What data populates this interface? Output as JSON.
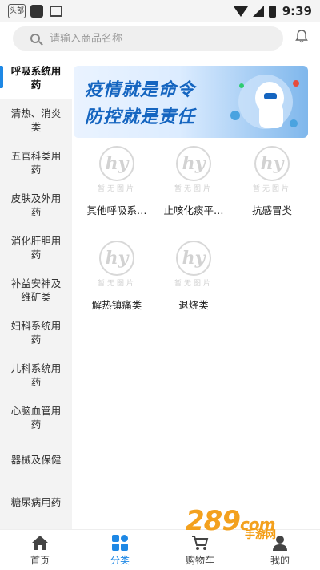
{
  "status_bar": {
    "app_badge": "头部",
    "time": "9:39"
  },
  "search": {
    "placeholder": "请输入商品名称"
  },
  "sidebar": {
    "items": [
      {
        "label": "呼吸系统用药",
        "active": true
      },
      {
        "label": "清热、消炎类"
      },
      {
        "label": "五官科类用药"
      },
      {
        "label": "皮肤及外用药"
      },
      {
        "label": "消化肝胆用药"
      },
      {
        "label": "补益安神及维矿类"
      },
      {
        "label": "妇科系统用药"
      },
      {
        "label": "儿科系统用药"
      },
      {
        "label": "心脑血管用药"
      },
      {
        "label": "器械及保健"
      },
      {
        "label": "糖尿病用药"
      }
    ]
  },
  "banner": {
    "line1": "疫情就是命令",
    "line2": "防控就是责任"
  },
  "placeholder_image": {
    "logo_text": "hy",
    "caption": "暂无图片"
  },
  "categories": [
    {
      "label": "其他呼吸系…"
    },
    {
      "label": "止咳化痰平…"
    },
    {
      "label": "抗感冒类"
    },
    {
      "label": "解热镇痛类"
    },
    {
      "label": "退烧类"
    }
  ],
  "bottom_nav": {
    "items": [
      {
        "label": "首页",
        "icon": "home-icon"
      },
      {
        "label": "分类",
        "icon": "category-icon",
        "active": true
      },
      {
        "label": "购物车",
        "icon": "cart-icon"
      },
      {
        "label": "我的",
        "icon": "profile-icon"
      }
    ]
  },
  "watermark": {
    "main": "289",
    "suffix": "com",
    "sub": "手游网"
  },
  "colors": {
    "accent": "#1e88e5",
    "banner_text": "#1565c0"
  }
}
